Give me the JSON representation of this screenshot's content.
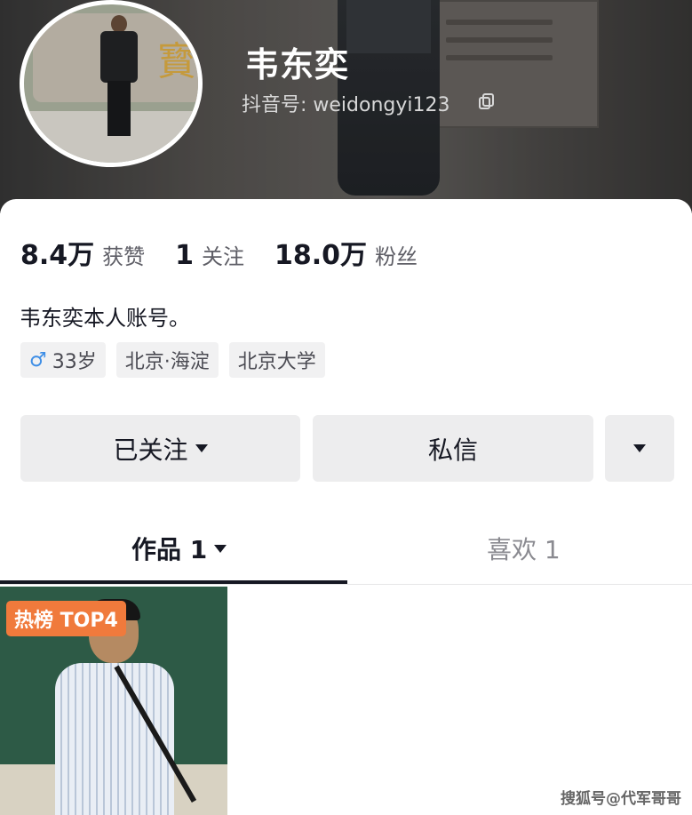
{
  "profile": {
    "name": "韦东奕",
    "douyin_id": "抖音号: weidongyi123",
    "bio": "韦东奕本人账号。"
  },
  "stats": [
    {
      "num": "8.4万",
      "label": "获赞"
    },
    {
      "num": "1",
      "label": "关注"
    },
    {
      "num": "18.0万",
      "label": "粉丝"
    }
  ],
  "tags": {
    "gender_symbol": "♂",
    "age": "33岁",
    "location": "北京·海淀",
    "school": "北京大学"
  },
  "actions": {
    "follow_label": "已关注",
    "message_label": "私信"
  },
  "tabs": {
    "works": "作品 1",
    "likes": "喜欢 1"
  },
  "video": {
    "badge": "热榜 TOP4"
  },
  "watermark": "搜狐号@代军哥哥",
  "colors": {
    "badge": "#f07a3c",
    "male_icon": "#3e8ee6",
    "button_bg": "#ededee"
  }
}
